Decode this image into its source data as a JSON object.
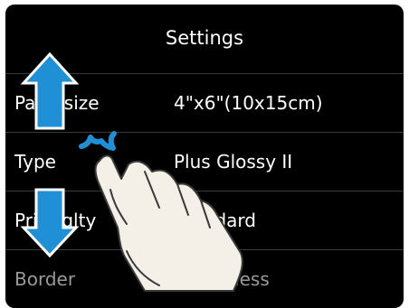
{
  "screen": {
    "title": "Settings"
  },
  "settings": [
    {
      "label": "Page size",
      "value": "4\"x6\"(10x15cm)"
    },
    {
      "label": "Type",
      "value": "Plus Glossy II"
    },
    {
      "label": "Print qlty",
      "value": "Standard"
    },
    {
      "label": "Border",
      "value": "Borderless"
    }
  ],
  "icons": {
    "up": "arrow-up-icon",
    "down": "arrow-down-icon",
    "touch": "tap-hand-icon",
    "tap": "tap-burst-icon"
  },
  "colors": {
    "arrow": "#1f8fd6",
    "background": "#000000",
    "text": "#ffffff"
  }
}
